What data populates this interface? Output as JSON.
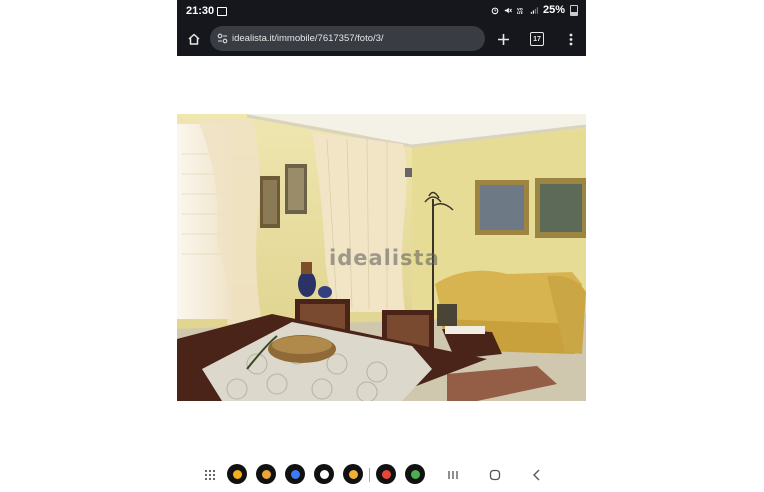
{
  "status_bar": {
    "time": "21:30",
    "battery": "25%"
  },
  "browser": {
    "url": "idealista.it/immobile/7617357/foto/3/",
    "tab_count": "17"
  },
  "photo": {
    "watermark": "idealista",
    "description_icon": "living-room-photo"
  },
  "dock": {
    "apps": [
      "phone-icon",
      "contacts-icon",
      "messages-icon",
      "play-store-icon",
      "camera-icon",
      "gmail-icon",
      "photos-icon"
    ]
  },
  "colors": {
    "browser_dark": "#15171c",
    "url_pill": "#3a3c44",
    "wall": "#e8de9a",
    "sofa": "#d8b450"
  }
}
